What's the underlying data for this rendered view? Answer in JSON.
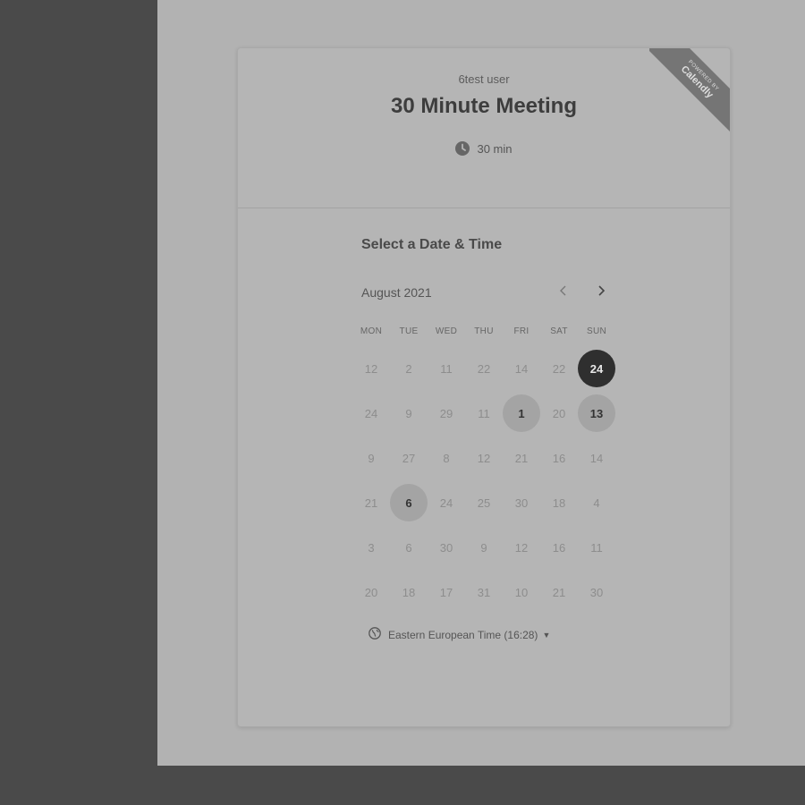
{
  "event": {
    "host": "6test user",
    "title": "30 Minute Meeting",
    "duration": "30 min"
  },
  "ribbon": {
    "powered_by": "POWERED BY",
    "brand": "Calendly"
  },
  "calendar": {
    "heading": "Select a Date & Time",
    "month": "August 2021",
    "weekdays": [
      "MON",
      "TUE",
      "WED",
      "THU",
      "FRI",
      "SAT",
      "SUN"
    ],
    "weeks": [
      [
        "12",
        "2",
        "11",
        "22",
        "14",
        "22",
        "24"
      ],
      [
        "24",
        "9",
        "29",
        "11",
        "1",
        "20",
        "13"
      ],
      [
        "9",
        "27",
        "8",
        "12",
        "21",
        "16",
        "14"
      ],
      [
        "21",
        "6",
        "24",
        "25",
        "30",
        "18",
        "4"
      ],
      [
        "3",
        "6",
        "30",
        "9",
        "12",
        "16",
        "11"
      ],
      [
        "20",
        "18",
        "17",
        "31",
        "10",
        "21",
        "30"
      ]
    ],
    "selected": [
      [
        0,
        6
      ]
    ],
    "available": [
      [
        1,
        4
      ],
      [
        1,
        6
      ],
      [
        3,
        1
      ]
    ]
  },
  "timezone": {
    "label": "Eastern European Time (16:28)"
  },
  "icons": {
    "clock": "clock-icon",
    "prev": "chevron-left-icon",
    "next": "chevron-right-icon",
    "globe": "globe-icon",
    "caret": "caret-down-icon"
  }
}
